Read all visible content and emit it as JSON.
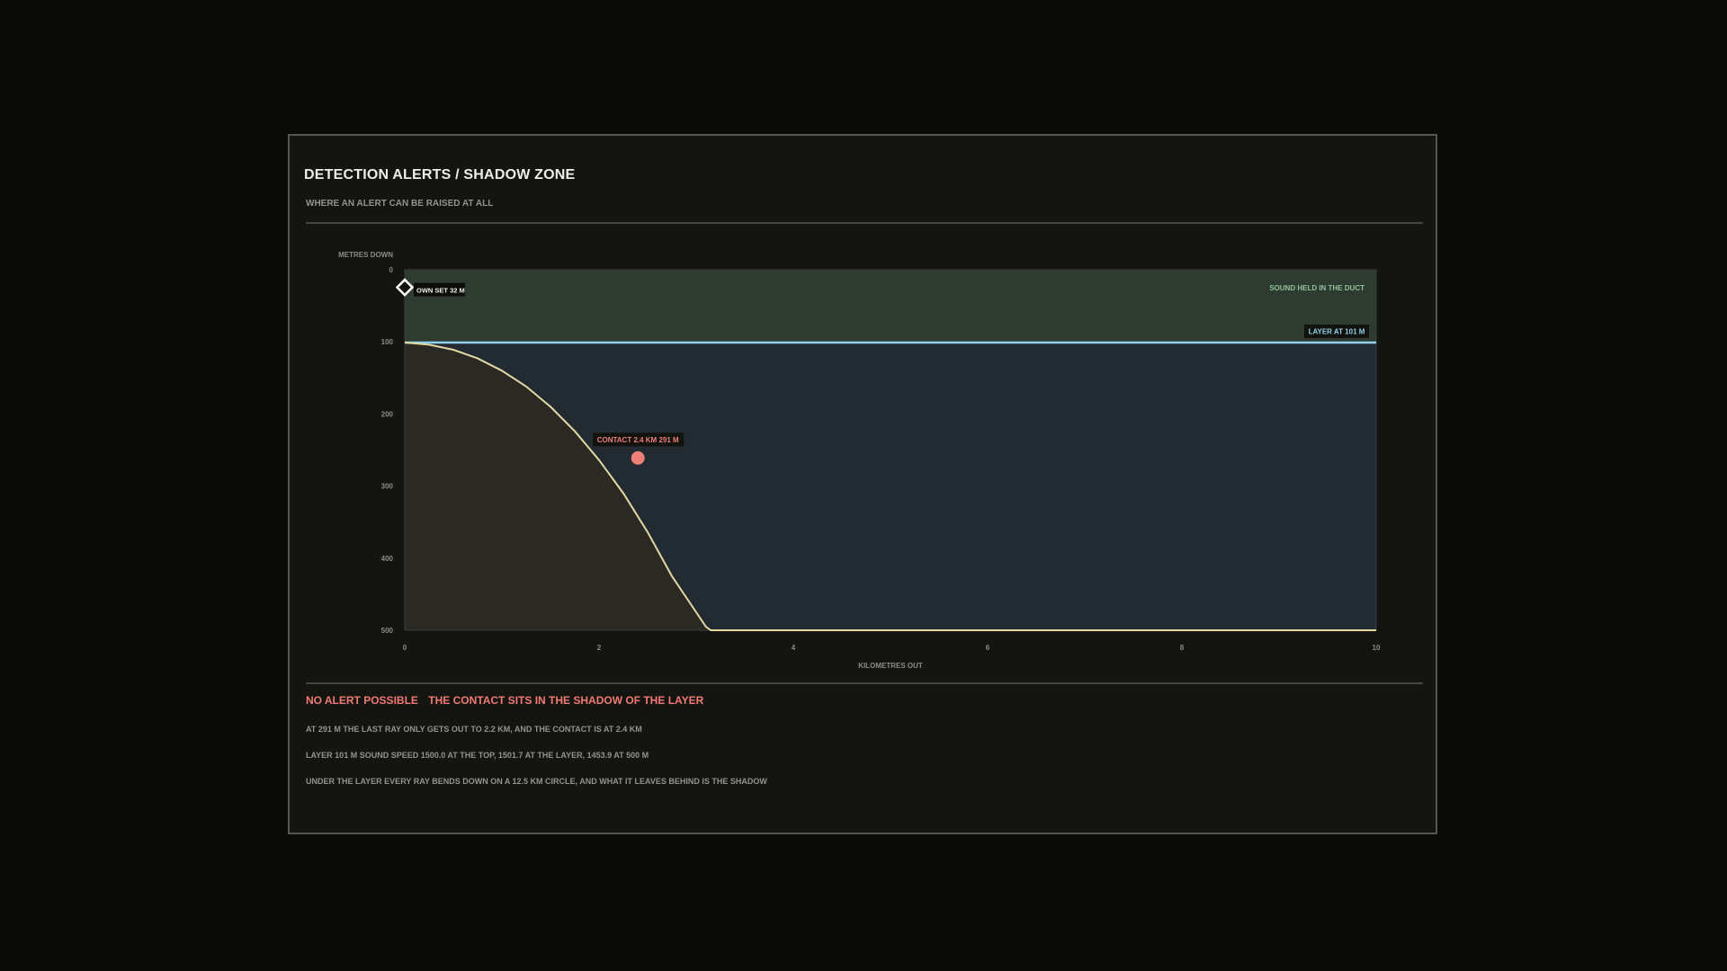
{
  "title": "DETECTION ALERTS / SHADOW ZONE",
  "subtitle": "WHERE AN ALERT CAN BE RAISED AT ALL",
  "colors": {
    "duct_fill": "#2e3b31",
    "below_fill": "#232b32",
    "shadow_fill": "#2a2924",
    "layer_line": "#8fd0ea",
    "ray": "#e3d8a2",
    "contact": "#ee7f79",
    "duct_text": "#8fc09c"
  },
  "chart_data": {
    "type": "line",
    "ylabel": "METRES DOWN",
    "xlabel": "KILOMETRES OUT",
    "xlim": [
      0,
      10
    ],
    "ylim": [
      0,
      500
    ],
    "y_inverted": true,
    "x_ticks": [
      "0",
      "2",
      "4",
      "6",
      "8",
      "10"
    ],
    "y_ticks": [
      "0",
      "100",
      "200",
      "300",
      "400",
      "500"
    ],
    "layer_depth_m": 101,
    "layer_label": "LAYER AT 101 M",
    "duct_label": "SOUND HELD IN THE DUCT",
    "own_ship": {
      "x_km": 0,
      "depth_m": 32,
      "label": "OWN SET 32 M"
    },
    "contact": {
      "x_km": 2.4,
      "depth_m": 291,
      "label": "CONTACT 2.4 KM  291 M"
    },
    "limiting_ray": {
      "x_km": [
        0,
        0.25,
        0.5,
        0.75,
        1.0,
        1.25,
        1.5,
        1.75,
        2.0,
        2.25,
        2.5,
        2.75,
        3.0,
        3.1,
        3.15,
        10
      ],
      "depth_m": [
        101,
        104,
        111,
        123,
        140,
        162,
        190,
        224,
        264,
        310,
        364,
        425,
        475,
        495,
        500,
        500
      ]
    }
  },
  "result": {
    "headline": "NO ALERT POSSIBLE",
    "reason": "THE CONTACT SITS IN THE SHADOW OF THE LAYER"
  },
  "notes": [
    "AT 291 M THE LAST RAY ONLY GETS OUT TO 2.2 KM, AND THE CONTACT IS AT 2.4 KM",
    "LAYER 101 M   SOUND SPEED 1500.0 AT THE TOP, 1501.7 AT THE LAYER, 1453.9 AT 500 M",
    "UNDER THE LAYER EVERY RAY BENDS DOWN ON A 12.5 KM CIRCLE, AND WHAT IT LEAVES BEHIND IS THE SHADOW"
  ]
}
